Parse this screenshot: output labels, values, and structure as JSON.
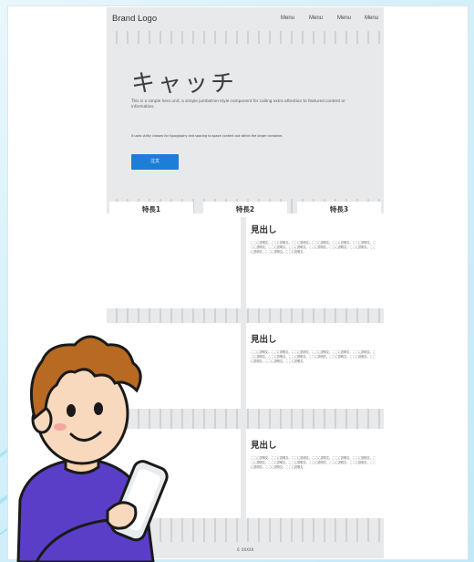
{
  "header": {
    "brand": "Brand Logo",
    "menu": [
      "Menu",
      "Menu",
      "Menu",
      "Menu"
    ]
  },
  "hero": {
    "catch": "キャッチ",
    "description": "This is a simple hero unit, a simple jumbotron-style component for calling extra attention to featured content or information.",
    "note": "It uses utility classes for typography and spacing to space content out within the larger container.",
    "button": "注文"
  },
  "features": [
    "特長1",
    "特長2",
    "特長3"
  ],
  "sections": [
    {
      "title": "見出し",
      "body": "ここに説明文。ここに説明文。ここに説明文。ここに説明文。ここに説明文。ここに説明文。ここに説明文。ここに説明文。ここに説明文。ここに説明文。ここに説明文。ここに説明文。ここに説明文。ここに説明文。ここに説明文。"
    },
    {
      "title": "見出し",
      "body": "ここに説明文。ここに説明文。ここに説明文。ここに説明文。ここに説明文。ここに説明文。ここに説明文。ここに説明文。ここに説明文。ここに説明文。ここに説明文。ここに説明文。ここに説明文。ここに説明文。ここに説明文。"
    },
    {
      "title": "見出し",
      "body": "ここに説明文。ここに説明文。ここに説明文。ここに説明文。ここに説明文。ここに説明文。ここに説明文。ここに説明文。ここに説明文。ここに説明文。ここに説明文。ここに説明文。ここに説明文。ここに説明文。ここに説明文。"
    }
  ],
  "footer": "© XXXXX",
  "colors": {
    "cta": "#1c7ed6",
    "page_bg": "#e7e9ea",
    "background": "#d4f0fa"
  },
  "illustration": "boy-holding-tablet-icon"
}
